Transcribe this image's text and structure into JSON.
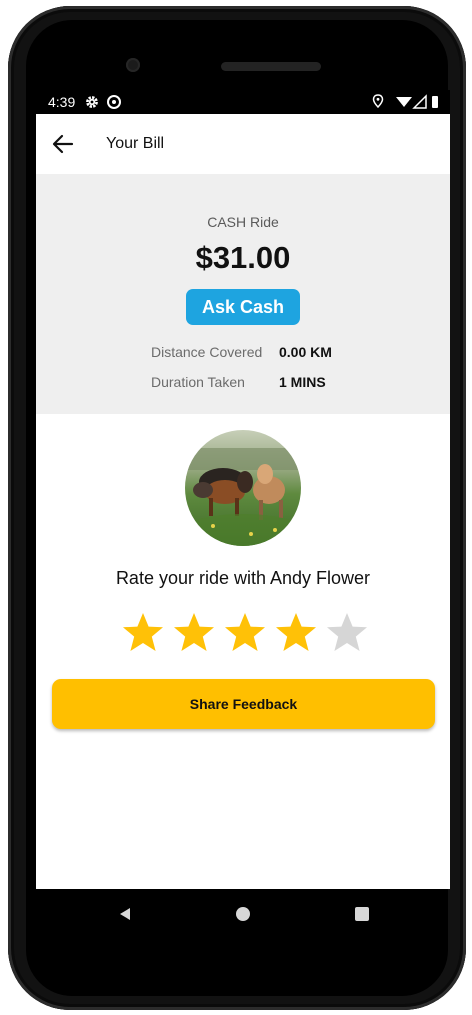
{
  "status_bar": {
    "time": "4:39",
    "icons": [
      "gear-icon",
      "sync-icon",
      "location-icon",
      "wifi-icon",
      "signal-icon",
      "battery-icon"
    ]
  },
  "app_bar": {
    "title": "Your Bill",
    "back_icon": "arrow-left-icon"
  },
  "bill": {
    "ride_type": "CASH Ride",
    "amount": "$31.00",
    "ask_cash_label": "Ask Cash",
    "distance_label": "Distance Covered",
    "distance_value": "0.00 KM",
    "duration_label": "Duration Taken",
    "duration_value": "1 MINS"
  },
  "rating": {
    "prompt": "Rate your ride with Andy Flower",
    "stars_filled": 4,
    "stars_total": 5,
    "filled_color": "#FFC107",
    "empty_color": "#D6D6D6"
  },
  "share_button_label": "Share Feedback",
  "colors": {
    "accent_blue": "#1EA4E0",
    "accent_yellow": "#FFBF00",
    "panel_gray": "#EFEFEF"
  },
  "nav_bar": {
    "icons": [
      "back-triangle-icon",
      "home-circle-icon",
      "recents-square-icon"
    ]
  }
}
